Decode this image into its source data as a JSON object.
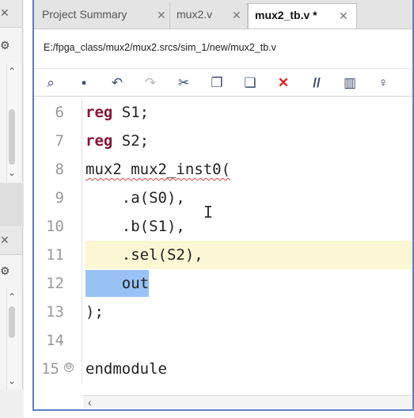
{
  "left_panels": {
    "close_glyph": "✕",
    "gear_glyph": "⚙",
    "up_glyph": "⌃",
    "down_glyph": "⌄"
  },
  "tabs": [
    {
      "label": "Project Summary",
      "active": false
    },
    {
      "label": "mux2.v",
      "active": false
    },
    {
      "label": "mux2_tb.v *",
      "active": true
    }
  ],
  "tab_close_glyph": "✕",
  "file_path": "E:/fpga_class/mux2/mux2.srcs/sim_1/new/mux2_tb.v",
  "toolbar": {
    "search": "⌕",
    "save": "▪",
    "undo": "↶",
    "redo": "↷",
    "cut": "✂",
    "copy": "❐",
    "paste": "❏",
    "delete": "✕",
    "comment": "//",
    "columns": "▥",
    "hint": "♀"
  },
  "code_lines": [
    {
      "num": "6",
      "kw": "reg",
      "rest": " S1;"
    },
    {
      "num": "7",
      "kw": "reg",
      "rest": " S2;"
    },
    {
      "num": "8",
      "text": "mux2 mux2_inst0("
    },
    {
      "num": "9",
      "text": "    .a(S0),"
    },
    {
      "num": "10",
      "text": "    .b(S1),"
    },
    {
      "num": "11",
      "text": "    .sel(S2),"
    },
    {
      "num": "12",
      "pre": "    ",
      "selected": "out"
    },
    {
      "num": "13",
      "text": ");"
    },
    {
      "num": "14",
      "text": ""
    },
    {
      "num": "15",
      "text": "endmodule",
      "fold": "⊖"
    }
  ],
  "text_cursor": "I",
  "hscroll_left": "‹",
  "colors": {
    "keyword": "#8a1538",
    "selection": "#98c2f4",
    "current_line": "#fbf7d4",
    "accent_border": "#5b7fbd"
  }
}
